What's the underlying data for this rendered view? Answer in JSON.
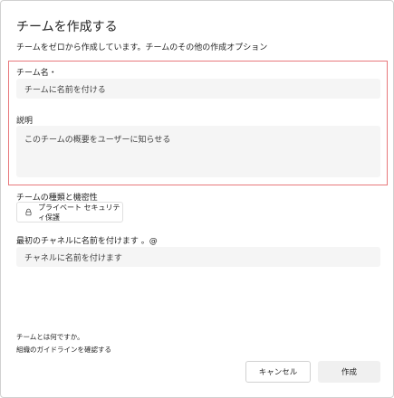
{
  "dialog": {
    "title": "チームを作成する",
    "subtitle": "チームをゼロから作成しています。チームのその他の作成オプション"
  },
  "team_name": {
    "label": "チーム名・",
    "placeholder": "チームに名前を付ける"
  },
  "description": {
    "label": "説明",
    "placeholder": "このチームの概要をユーザーに知らせる"
  },
  "privacy": {
    "label": "チームの種類と機密性",
    "value": "プライベート セキュリティ保護",
    "icon": "lock-icon"
  },
  "channel": {
    "label": "最初のチャネルに名前を付けます 。@",
    "placeholder": "チャネルに名前を付けます"
  },
  "footer_links": {
    "what_is_team": "チームとは何ですか。",
    "guidelines": "組織のガイドラインを確認する"
  },
  "buttons": {
    "cancel": "キャンセル",
    "create": "作成"
  },
  "colors": {
    "highlight_border": "#e8787c",
    "field_background": "#f5f5f5"
  }
}
